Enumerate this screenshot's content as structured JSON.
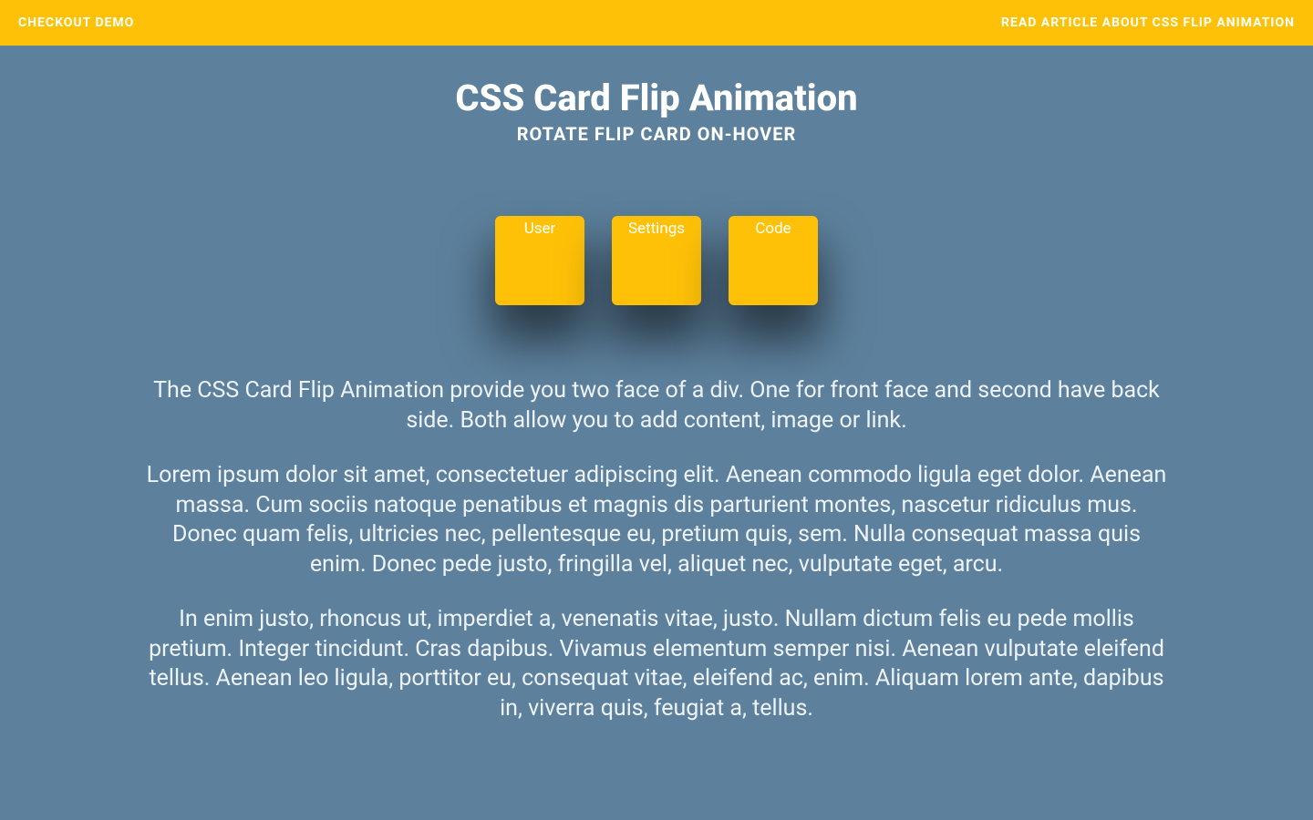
{
  "topbar": {
    "left_link": "CHECKOUT DEMO",
    "right_link": "READ ARTICLE ABOUT CSS FLIP ANIMATION"
  },
  "hero": {
    "title": "CSS Card Flip Animation",
    "subtitle": "ROTATE FLIP CARD ON-HOVER"
  },
  "cards": [
    {
      "label": "User"
    },
    {
      "label": "Settings"
    },
    {
      "label": "Code"
    }
  ],
  "content": {
    "p1": "The CSS Card Flip Animation provide you two face of a div. One for front face and second have back side. Both allow you to add content, image or link.",
    "p2": "Lorem ipsum dolor sit amet, consectetuer adipiscing elit. Aenean commodo ligula eget dolor. Aenean massa. Cum sociis natoque penatibus et magnis dis parturient montes, nascetur ridiculus mus. Donec quam felis, ultricies nec, pellentesque eu, pretium quis, sem. Nulla consequat massa quis enim. Donec pede justo, fringilla vel, aliquet nec, vulputate eget, arcu.",
    "p3": "In enim justo, rhoncus ut, imperdiet a, venenatis vitae, justo. Nullam dictum felis eu pede mollis pretium. Integer tincidunt. Cras dapibus. Vivamus elementum semper nisi. Aenean vulputate eleifend tellus. Aenean leo ligula, porttitor eu, consequat vitae, eleifend ac, enim. Aliquam lorem ante, dapibus in, viverra quis, feugiat a, tellus."
  },
  "colors": {
    "accent": "#ffc107",
    "background": "#5d819d"
  }
}
